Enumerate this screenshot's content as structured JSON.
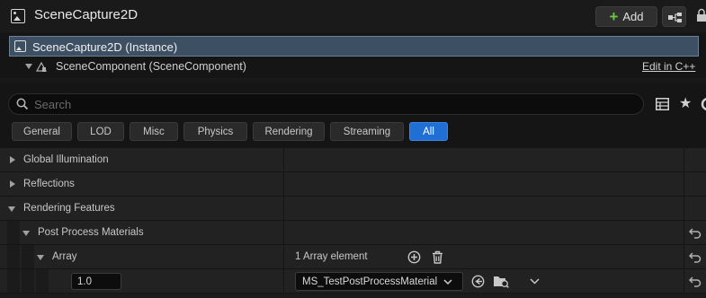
{
  "header": {
    "title": "SceneCapture2D",
    "add_label": "Add",
    "icon": "scene-capture-icon"
  },
  "tree": {
    "root_label": "SceneCapture2D (Instance)",
    "child_label": "SceneComponent (SceneComponent)",
    "edit_link": "Edit in C++"
  },
  "search": {
    "placeholder": "Search",
    "value": ""
  },
  "filter_tabs": [
    {
      "label": "General"
    },
    {
      "label": "LOD"
    },
    {
      "label": "Misc"
    },
    {
      "label": "Physics"
    },
    {
      "label": "Rendering"
    },
    {
      "label": "Streaming"
    },
    {
      "label": "All",
      "active": true
    }
  ],
  "properties": {
    "global_illumination": "Global Illumination",
    "reflections": "Reflections",
    "rendering_features": "Rendering Features",
    "post_process_materials": "Post Process Materials",
    "array": "Array",
    "array_count": "1 Array element",
    "element_weight": "1.0",
    "element_material": "MS_TestPostProcessMaterial"
  },
  "colors": {
    "accent": "#1f6fd4",
    "add_green": "#6cc34a",
    "selection": "#3d4f63"
  }
}
